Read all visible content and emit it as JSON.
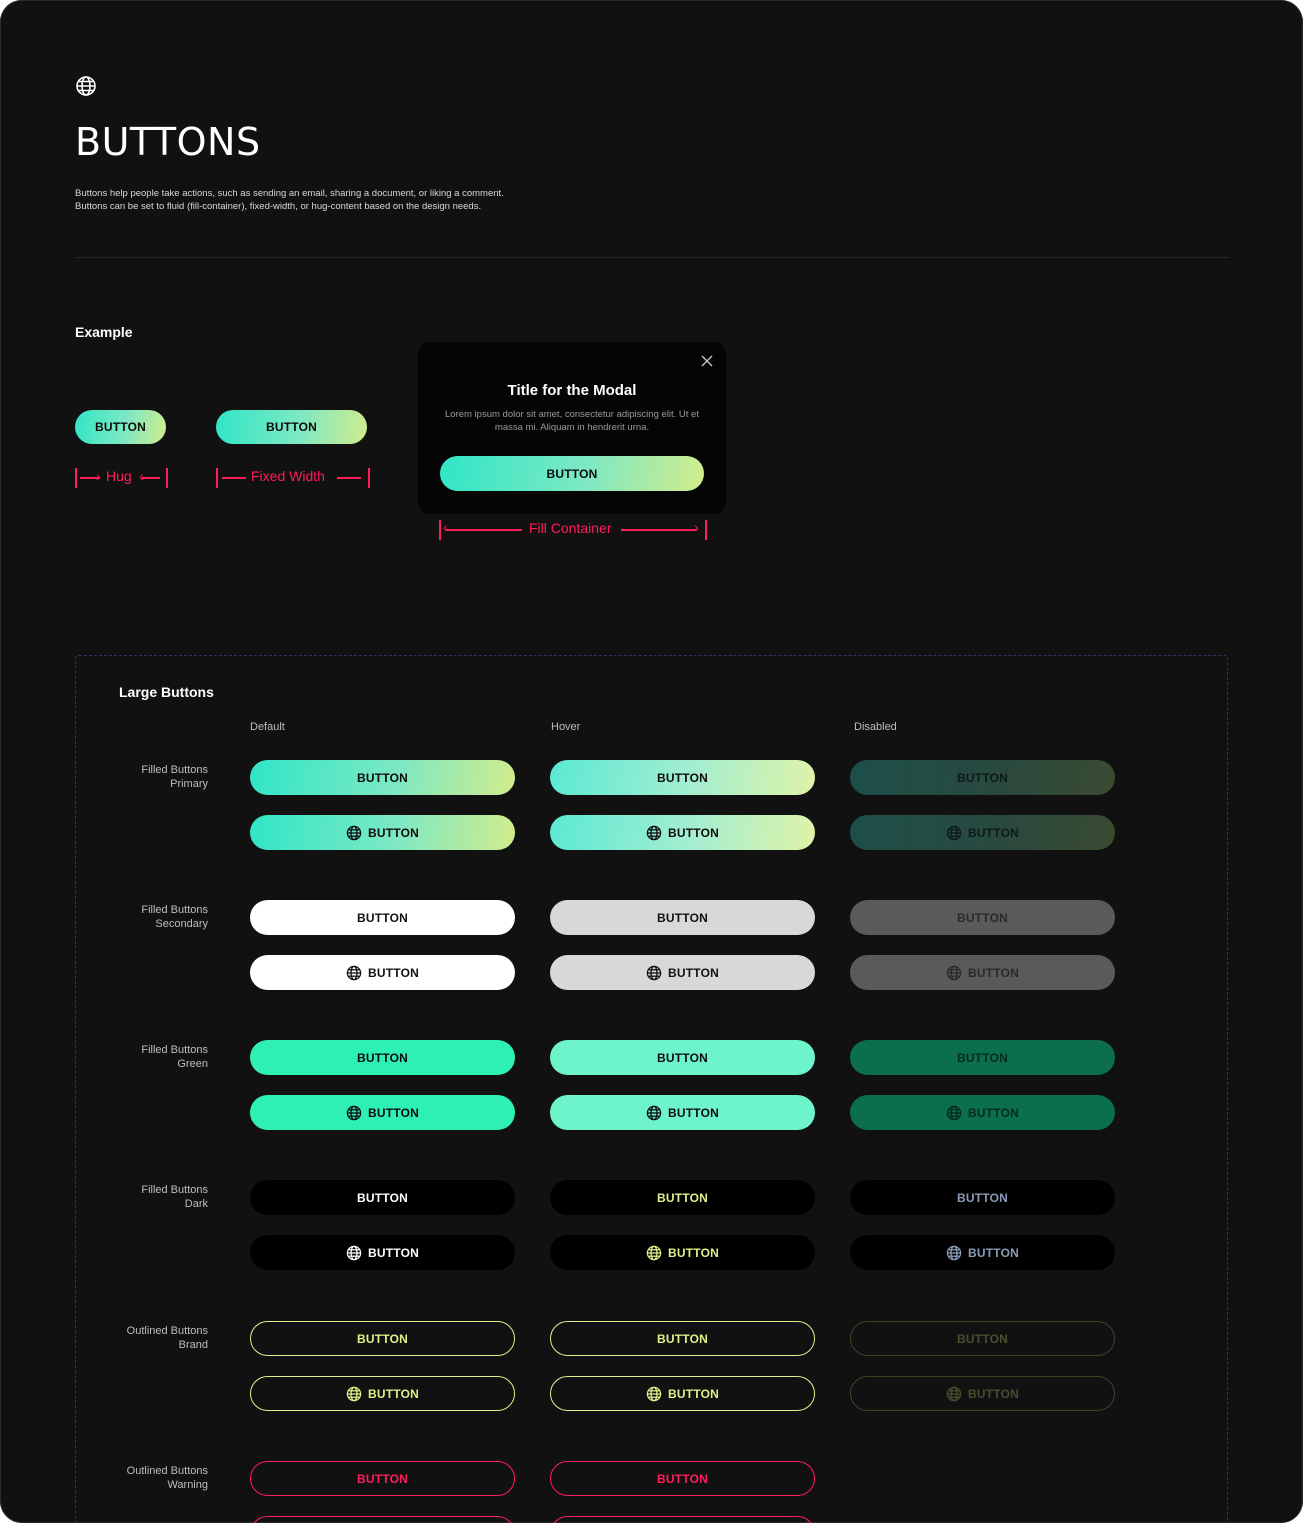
{
  "header": {
    "logo_icon": "globe-icon",
    "title": "BUTTONS",
    "description_line1": "Buttons help people take actions, such as sending an email, sharing a document, or liking a comment.",
    "description_line2": "Buttons can be set to fluid (fill-container), fixed-width, or hug-content based on the design needs."
  },
  "example": {
    "label": "Example",
    "hug_button": "BUTTON",
    "fixed_button": "BUTTON",
    "hug_label": "Hug",
    "fixed_label": "Fixed Width",
    "fill_label": "Fill Container",
    "modal": {
      "title": "Title for the Modal",
      "text": "Lorem ipsum dolor sit amet, consectetur adipiscing elit. Ut et massa mi. Aliquam in hendrerit urna.",
      "button": "BUTTON",
      "close_icon": "close-icon"
    }
  },
  "large": {
    "title": "Large Buttons",
    "columns": [
      "Default",
      "Hover",
      "Disabled"
    ],
    "rows": [
      {
        "line1": "Filled Buttons",
        "line2": "Primary"
      },
      {
        "line1": "Filled Buttons",
        "line2": "Secondary"
      },
      {
        "line1": "Filled Buttons",
        "line2": "Green"
      },
      {
        "line1": "Filled Buttons",
        "line2": "Dark"
      },
      {
        "line1": "Outlined Buttons",
        "line2": "Brand"
      },
      {
        "line1": "Outlined Buttons",
        "line2": "Warning"
      }
    ],
    "button_label": "BUTTON",
    "button_icon": "globe-icon"
  },
  "colors": {
    "background": "#111111",
    "brand_gradient_start": "#2fe6c6",
    "brand_gradient_end": "#d2ec8c",
    "green": "#2ef0b4",
    "brand_yellow": "#dff18a",
    "warning": "#ff1e5a"
  }
}
